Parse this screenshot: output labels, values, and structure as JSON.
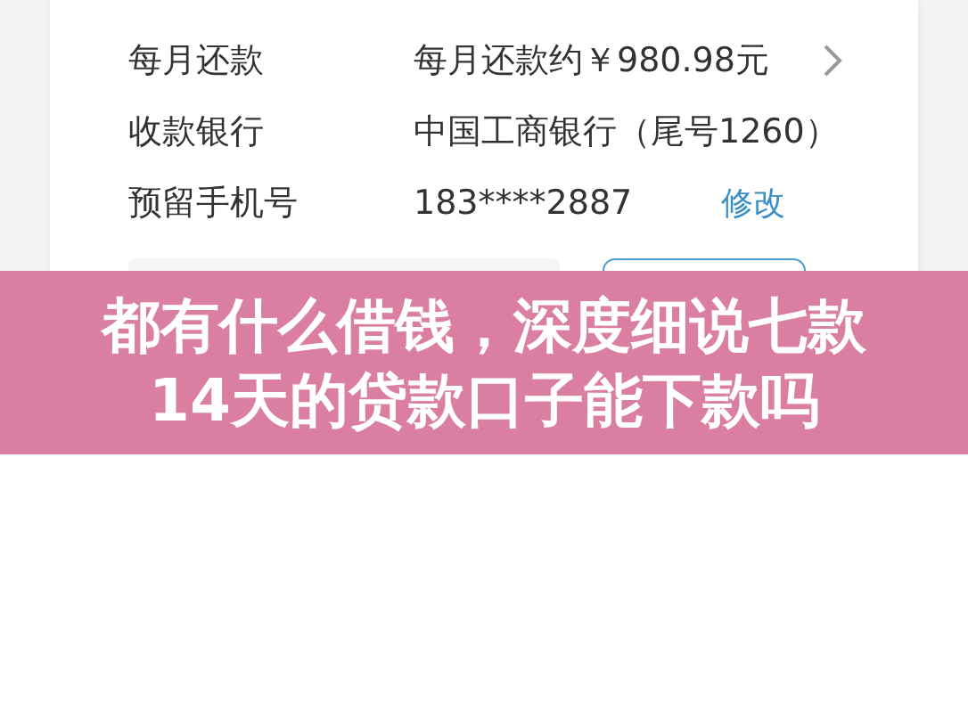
{
  "form": {
    "rows": [
      {
        "label": "每月还款",
        "value": "每月还款约￥980.98元",
        "kind": "link"
      },
      {
        "label": "收款银行",
        "value": "中国工商银行（尾号1260）",
        "kind": "plain"
      },
      {
        "label": "预留手机号",
        "value": "183****2887",
        "action": "修改",
        "kind": "action"
      }
    ]
  },
  "banner": {
    "lines": [
      "都有什么借钱，深度细说七款",
      "14天的贷款口子能下款吗"
    ]
  }
}
